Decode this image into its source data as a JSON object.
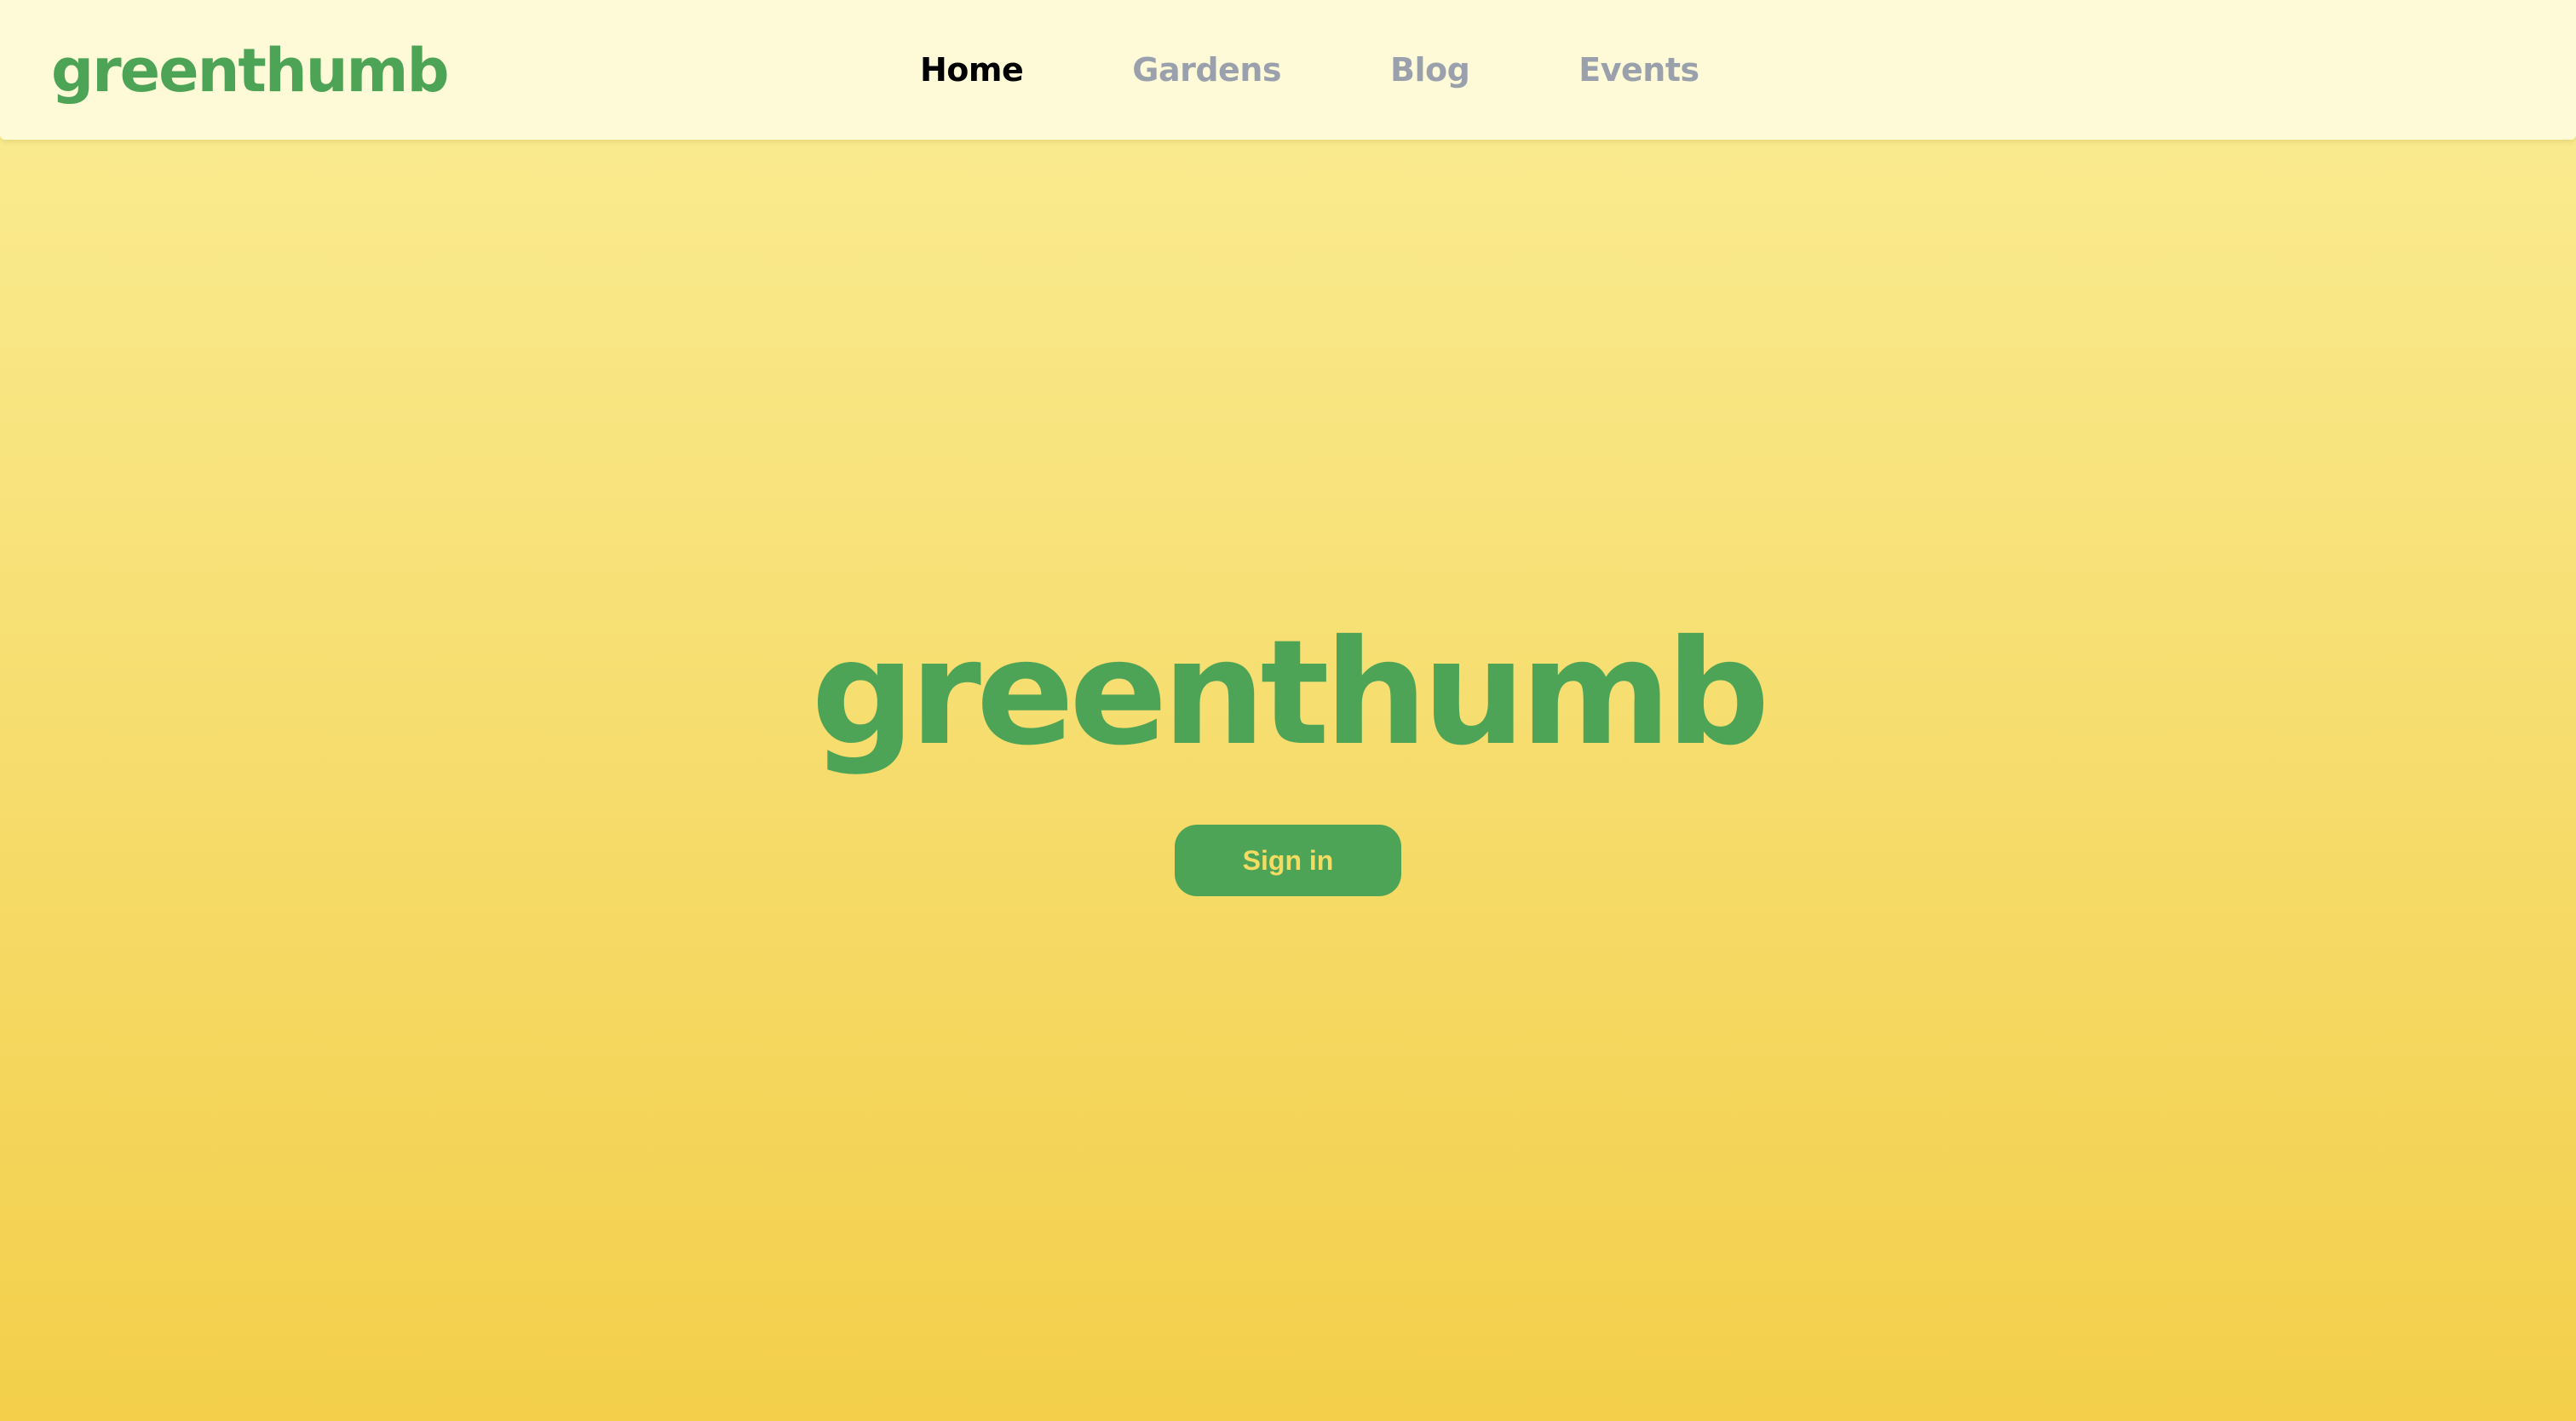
{
  "header": {
    "brand": "greenthumb",
    "nav": {
      "home": "Home",
      "gardens": "Gardens",
      "blog": "Blog",
      "events": "Events"
    },
    "active_nav": "Home"
  },
  "hero": {
    "title": "greenthumb",
    "sign_in_label": "Sign in"
  },
  "colors": {
    "brand_green": "#4ea456",
    "header_background": "#fefad8",
    "nav_inactive": "#9aa1ac",
    "nav_active": "#000000",
    "gradient_top": "#fbee96",
    "gradient_bottom": "#f3cf4a",
    "button_text": "#f4dc63"
  }
}
